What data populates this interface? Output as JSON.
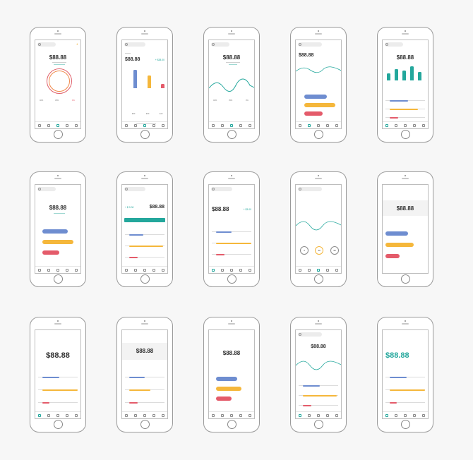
{
  "balance": "$88.88",
  "colors": {
    "teal": "#23a79c",
    "blue": "#6e8dd0",
    "yellow": "#f5b73b",
    "red": "#e45b6a",
    "ring_red": "#e0606b",
    "ring_orange": "#f08a4b"
  },
  "screens": [
    {
      "id": "s1"
    },
    {
      "id": "s2"
    },
    {
      "id": "s3"
    },
    {
      "id": "s4"
    },
    {
      "id": "s5"
    },
    {
      "id": "s6"
    },
    {
      "id": "s7"
    },
    {
      "id": "s8"
    },
    {
      "id": "s9"
    },
    {
      "id": "s10"
    },
    {
      "id": "s11"
    },
    {
      "id": "s12"
    },
    {
      "id": "s13"
    },
    {
      "id": "s14"
    },
    {
      "id": "s15"
    }
  ]
}
